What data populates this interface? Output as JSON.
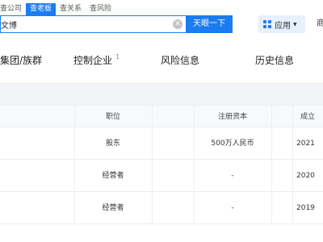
{
  "top_tabs": [
    {
      "label": "查公司",
      "active": false
    },
    {
      "label": "查老板",
      "active": true
    },
    {
      "label": "查关系",
      "active": false
    },
    {
      "label": "查风险",
      "active": false
    }
  ],
  "search": {
    "value": "文博",
    "button_label": "天眼一下"
  },
  "header_right": {
    "apps_label": "应用",
    "more_label": "商"
  },
  "nav": [
    {
      "label": "集团/族群",
      "count": ""
    },
    {
      "label": "控制企业",
      "count": "1"
    },
    {
      "label": "风险信息",
      "count": ""
    },
    {
      "label": "历史信息",
      "count": ""
    }
  ],
  "table": {
    "headers": [
      "职位",
      "注册资本",
      "成立"
    ],
    "rows": [
      {
        "position": "股东",
        "capital": "500万人民币",
        "date": "2021"
      },
      {
        "position": "经营者",
        "capital": "-",
        "date": "2020"
      },
      {
        "position": "经营者",
        "capital": "-",
        "date": "2019"
      }
    ]
  }
}
